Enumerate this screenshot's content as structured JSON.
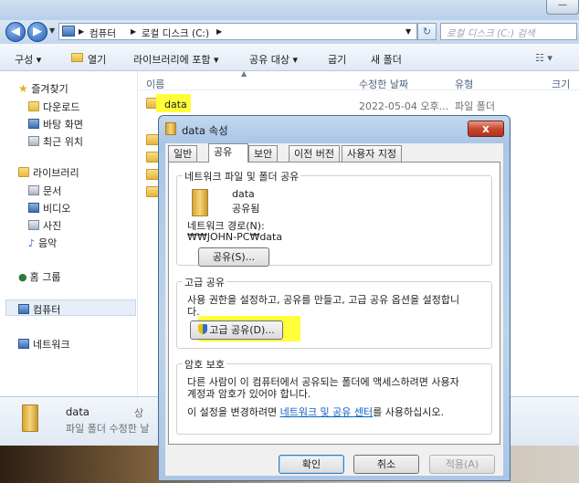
{
  "address_bar": {
    "segments": [
      "컴퓨터",
      "로컬 디스크 (C:)"
    ],
    "search_placeholder": "로컬 디스크 (C:) 검색"
  },
  "command_bar": {
    "organize": "구성 ▾",
    "open": "열기",
    "include_library": "라이브러리에 포함 ▾",
    "share_with": "공유 대상 ▾",
    "burn": "굽기",
    "new_folder": "새 폴더"
  },
  "sidebar": {
    "favorites": "즐겨찾기",
    "downloads": "다운로드",
    "desktop": "바탕 화면",
    "recent": "최근 위치",
    "libraries": "라이브러리",
    "documents": "문서",
    "videos": "비디오",
    "pictures": "사진",
    "music": "음악",
    "homegroup": "홈 그룹",
    "computer": "컴퓨터",
    "network": "네트워크"
  },
  "file_list": {
    "columns": [
      "이름",
      "수정한 날짜",
      "유형",
      "크기"
    ],
    "rows": [
      {
        "name": "data",
        "modified": "2022-05-04 오후...",
        "type": "파일 폴더"
      }
    ]
  },
  "details_pane": {
    "name": "data",
    "line1_prefix": "상",
    "line2": "파일 폴더 수정한 날"
  },
  "dialog": {
    "title": "data 속성",
    "close_label": "x",
    "tabs": [
      "일반",
      "공유",
      "보안",
      "이전 버전",
      "사용자 지정"
    ],
    "active_tab": "공유",
    "network_sharing": {
      "group_label": "네트워크 파일 및 폴더 공유",
      "folder_name": "data",
      "status": "공유됨",
      "path_label": "네트워크 경로(N):",
      "path_value": "₩₩JOHN-PC₩data",
      "share_button": "공유(S)..."
    },
    "advanced_sharing": {
      "group_label": "고급 공유",
      "description_line1": "사용 권한을 설정하고, 공유를 만들고, 고급 공유 옵션을 설정합니",
      "description_line2": "다.",
      "button": "고급 공유(D)..."
    },
    "password_protection": {
      "group_label": "암호 보호",
      "description_line1": "다른 사람이 이 컴퓨터에서 공유되는 폴더에 액세스하려면 사용자",
      "description_line2": "계정과 암호가 있어야 합니다.",
      "change_prefix": "이 설정을 변경하려면 ",
      "link_text": "네트워크 및 공유 센터",
      "change_suffix": "를 사용하십시오."
    },
    "buttons": {
      "ok": "확인",
      "cancel": "취소",
      "apply": "적용(A)"
    }
  }
}
